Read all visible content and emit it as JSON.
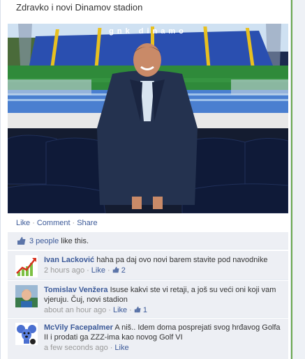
{
  "post": {
    "title": "Zdravko i novi Dinamov stadion",
    "photo": {
      "stadium_banner": "gnk dinamo",
      "colors": {
        "seats": "#2a4fb0",
        "grass": "#2f8a3a",
        "suit": "#24324f",
        "sky": "#cfe1f2"
      }
    },
    "actions": {
      "like": "Like",
      "comment": "Comment",
      "share": "Share",
      "separator": "·"
    }
  },
  "likes": {
    "count_link": "3 people",
    "suffix": " like this."
  },
  "comments": [
    {
      "author": "Ivan Lacković",
      "text": "haha pa daj ovo novi barem stavite pod navodnike",
      "time": "2 hours ago",
      "like": "Like",
      "like_count": "2",
      "avatar_icon": "growth-chart-icon"
    },
    {
      "author": "Tomislav Venžera",
      "text": "Isuse kakvi ste vi retaji, a još su veći oni koji vam vjeruju. Čuj, novi stadion",
      "time": "about an hour ago",
      "like": "Like",
      "like_count": "1",
      "avatar_icon": "person-photo-icon"
    },
    {
      "author": "McVily Facepalmer",
      "text": "A niš.. Idem doma posprejati svog hrđavog Golfa II i prodati ga ZZZ-ima kao novog Golf VI",
      "time": "a few seconds ago",
      "like": "Like",
      "avatar_icon": "cartoon-mouse-icon"
    }
  ],
  "theme": {
    "link": "#3b5998",
    "feedback_bg": "#edeff4",
    "meta": "#999999"
  }
}
